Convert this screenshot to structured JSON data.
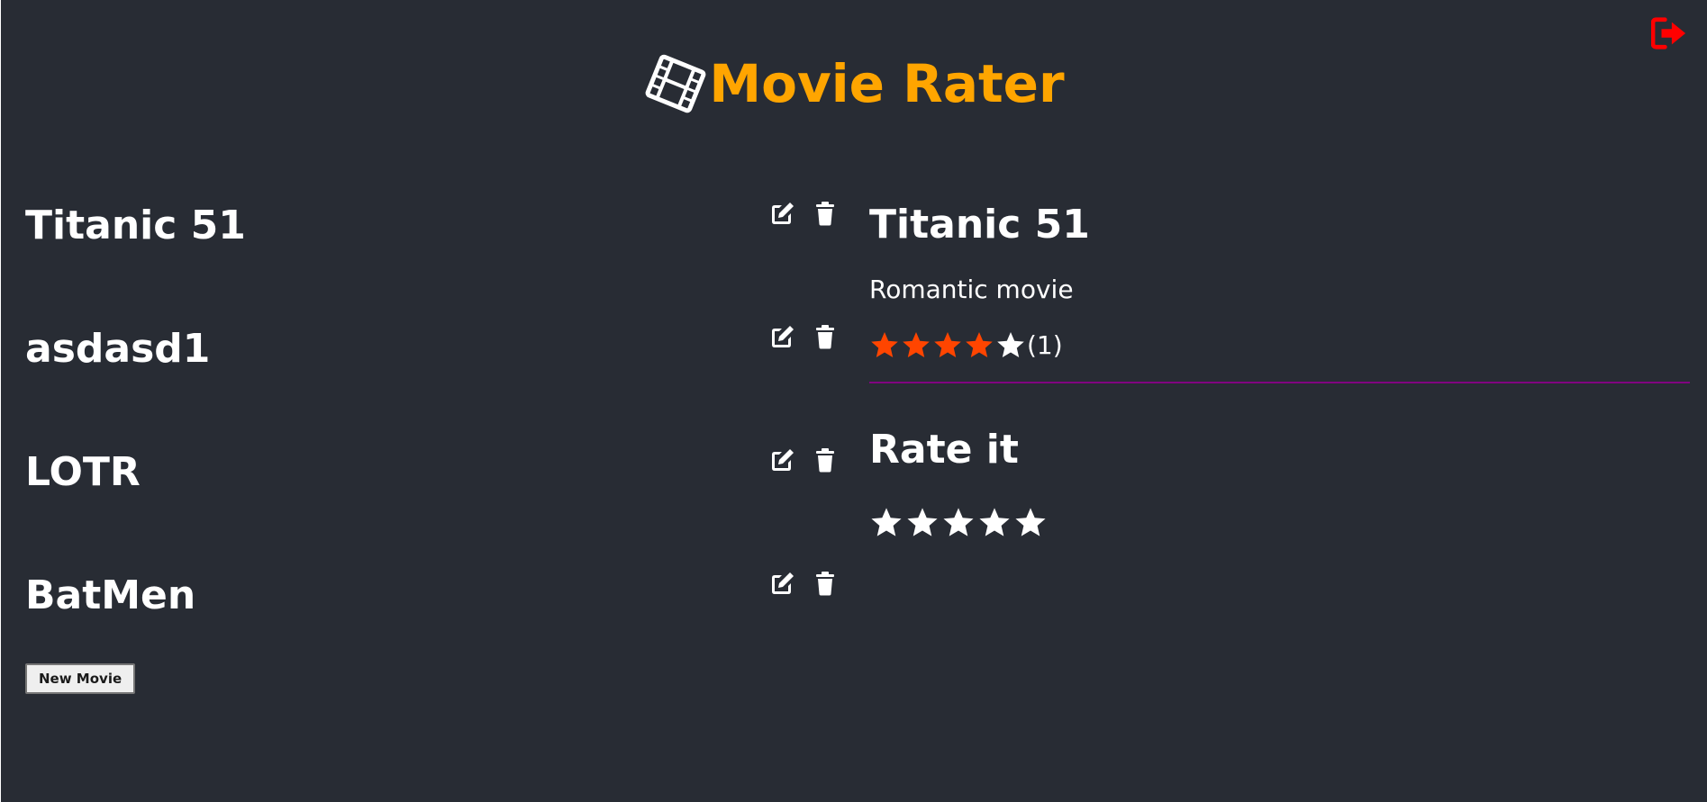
{
  "app": {
    "title": "Movie Rater",
    "title_color": "#ffa500",
    "background": "#282c34",
    "logo_icon": "film-icon",
    "logout_icon": "sign-out-icon",
    "logout_color": "#ff0000"
  },
  "movies": [
    {
      "title": "Titanic 51",
      "edit_icon": "edit-icon",
      "delete_icon": "trash-icon"
    },
    {
      "title": "asdasd1",
      "edit_icon": "edit-icon",
      "delete_icon": "trash-icon"
    },
    {
      "title": "LOTR",
      "edit_icon": "edit-icon",
      "delete_icon": "trash-icon"
    },
    {
      "title": "BatMen",
      "edit_icon": "edit-icon",
      "delete_icon": "trash-icon"
    }
  ],
  "new_movie_label": "New Movie",
  "details": {
    "title": "Titanic 51",
    "description": "Romantic movie",
    "avg_rating": 4,
    "max_rating": 5,
    "rating_count": "(1)",
    "filled_star_color": "#ff4500",
    "empty_star_color": "#ffffff",
    "divider_color": "#800080"
  },
  "rate_section": {
    "title": "Rate it",
    "stars": 5,
    "selected": 0
  }
}
